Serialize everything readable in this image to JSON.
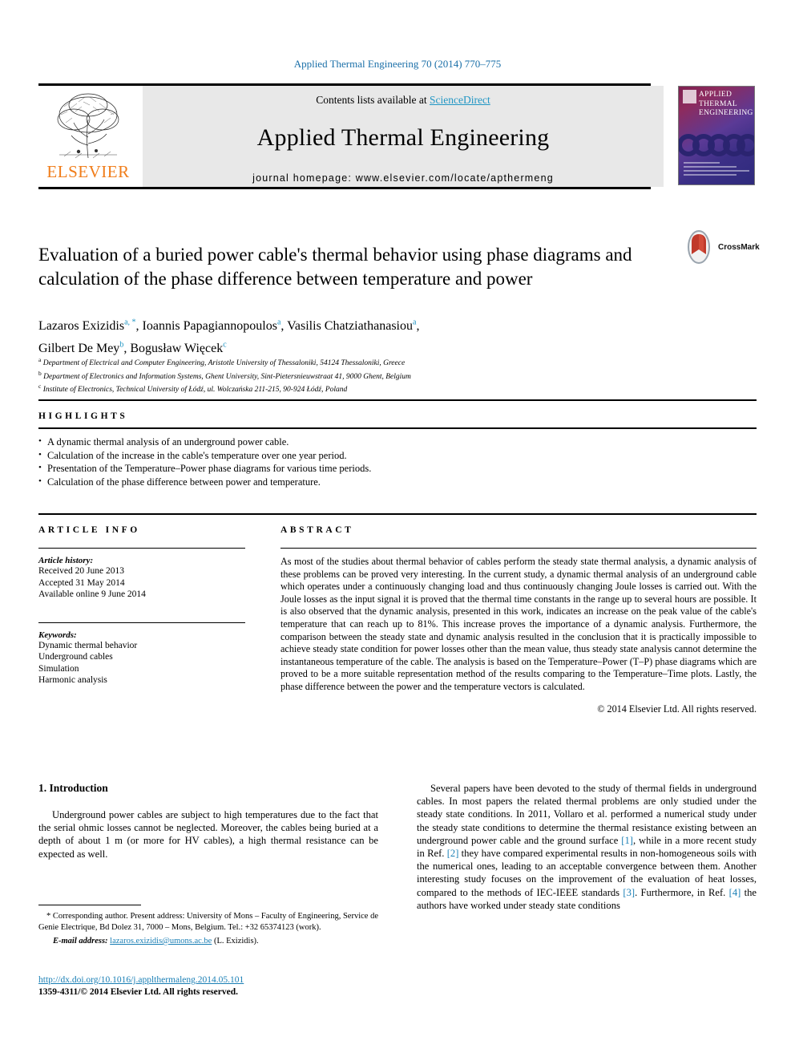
{
  "running_head": "Applied Thermal Engineering 70 (2014) 770–775",
  "masthead": {
    "contents_prefix": "Contents lists available at ",
    "sciencedirect": "ScienceDirect",
    "journal_title": "Applied Thermal Engineering",
    "homepage": "journal homepage: www.elsevier.com/locate/apthermeng",
    "publisher": "ELSEVIER",
    "cover_title_lines": [
      "APPLIED",
      "THERMAL",
      "ENGINEERING"
    ]
  },
  "article": {
    "title": "Evaluation of a buried power cable's thermal behavior using phase diagrams and calculation of the phase difference between temperature and power",
    "crossmark_label": "CrossMark",
    "authors": [
      {
        "name": "Lazaros Exizidis",
        "marks": "a, *",
        "sep": ", "
      },
      {
        "name": "Ioannis Papagiannopoulos",
        "marks": "a",
        "sep": ", "
      },
      {
        "name": "Vasilis Chatziathanasiou",
        "marks": "a",
        "sep": ", "
      },
      {
        "name": "Gilbert De Mey",
        "marks": "b",
        "sep": ", "
      },
      {
        "name": "Bogusław Więcek",
        "marks": "c",
        "sep": ""
      }
    ],
    "affiliations": [
      {
        "mark": "a",
        "text": "Department of Electrical and Computer Engineering, Aristotle University of Thessaloniki, 54124 Thessaloniki, Greece"
      },
      {
        "mark": "b",
        "text": "Department of Electronics and Information Systems, Ghent University, Sint-Pietersnieuwstraat 41, 9000 Ghent, Belgium"
      },
      {
        "mark": "c",
        "text": "Institute of Electronics, Technical University of Łódź, ul. Wolczańska 211-215, 90-924 Łódź, Poland"
      }
    ]
  },
  "highlights": {
    "heading": "HIGHLIGHTS",
    "items": [
      "A dynamic thermal analysis of an underground power cable.",
      "Calculation of the increase in the cable's temperature over one year period.",
      "Presentation of the Temperature–Power phase diagrams for various time periods.",
      "Calculation of the phase difference between power and temperature."
    ]
  },
  "article_info": {
    "heading": "ARTICLE INFO",
    "history_label": "Article history:",
    "history": [
      "Received 20 June 2013",
      "Accepted 31 May 2014",
      "Available online 9 June 2014"
    ],
    "keywords_label": "Keywords:",
    "keywords": [
      "Dynamic thermal behavior",
      "Underground cables",
      "Simulation",
      "Harmonic analysis"
    ]
  },
  "abstract": {
    "heading": "ABSTRACT",
    "text": "As most of the studies about thermal behavior of cables perform the steady state thermal analysis, a dynamic analysis of these problems can be proved very interesting. In the current study, a dynamic thermal analysis of an underground cable which operates under a continuously changing load and thus continuously changing Joule losses is carried out. With the Joule losses as the input signal it is proved that the thermal time constants in the range up to several hours are possible. It is also observed that the dynamic analysis, presented in this work, indicates an increase on the peak value of the cable's temperature that can reach up to 81%. This increase proves the importance of a dynamic analysis. Furthermore, the comparison between the steady state and dynamic analysis resulted in the conclusion that it is practically impossible to achieve steady state condition for power losses other than the mean value, thus steady state analysis cannot determine the instantaneous temperature of the cable. The analysis is based on the Temperature–Power (T–P) phase diagrams which are proved to be a more suitable representation method of the results comparing to the Temperature–Time plots. Lastly, the phase difference between the power and the temperature vectors is calculated.",
    "copyright": "© 2014 Elsevier Ltd. All rights reserved."
  },
  "body": {
    "section_number_title": "1. Introduction",
    "left_paragraph": "Underground power cables are subject to high temperatures due to the fact that the serial ohmic losses cannot be neglected. Moreover, the cables being buried at a depth of about 1 m (or more for HV cables), a high thermal resistance can be expected as well.",
    "right_paragraph_part1": "Several papers have been devoted to the study of thermal fields in underground cables. In most papers the related thermal problems are only studied under the steady state conditions. In 2011, Vollaro et al. performed a numerical study under the steady state conditions to determine the thermal resistance existing between an underground power cable and the ground surface ",
    "right_ref1": "[1]",
    "right_paragraph_part2": ", while in a more recent study in Ref. ",
    "right_ref2": "[2]",
    "right_paragraph_part3": " they have compared experimental results in non-homogeneous soils with the numerical ones, leading to an acceptable convergence between them. Another interesting study focuses on the improvement of the evaluation of heat losses, compared to the methods of IEC-IEEE standards ",
    "right_ref3": "[3]",
    "right_paragraph_part4": ". Furthermore, in Ref. ",
    "right_ref4": "[4]",
    "right_paragraph_part5": " the authors have worked under steady state conditions"
  },
  "footnotes": {
    "corresponding": "* Corresponding author. Present address: University of Mons – Faculty of Engineering, Service de Genie Electrique, Bd Dolez 31, 7000 – Mons, Belgium. Tel.: +32 65374123 (work).",
    "email_label": "E-mail address:",
    "email": "lazaros.exizidis@umons.ac.be",
    "email_suffix": "(L. Exizidis)."
  },
  "footer": {
    "doi": "http://dx.doi.org/10.1016/j.applthermaleng.2014.05.101",
    "issn": "1359-4311/© 2014 Elsevier Ltd. All rights reserved."
  },
  "colors": {
    "link_blue": "#1a7fb5",
    "sciencedirect_blue": "#2196c4",
    "elsevier_orange": "#F07D1A",
    "crossmark_red": "#c0392b"
  }
}
